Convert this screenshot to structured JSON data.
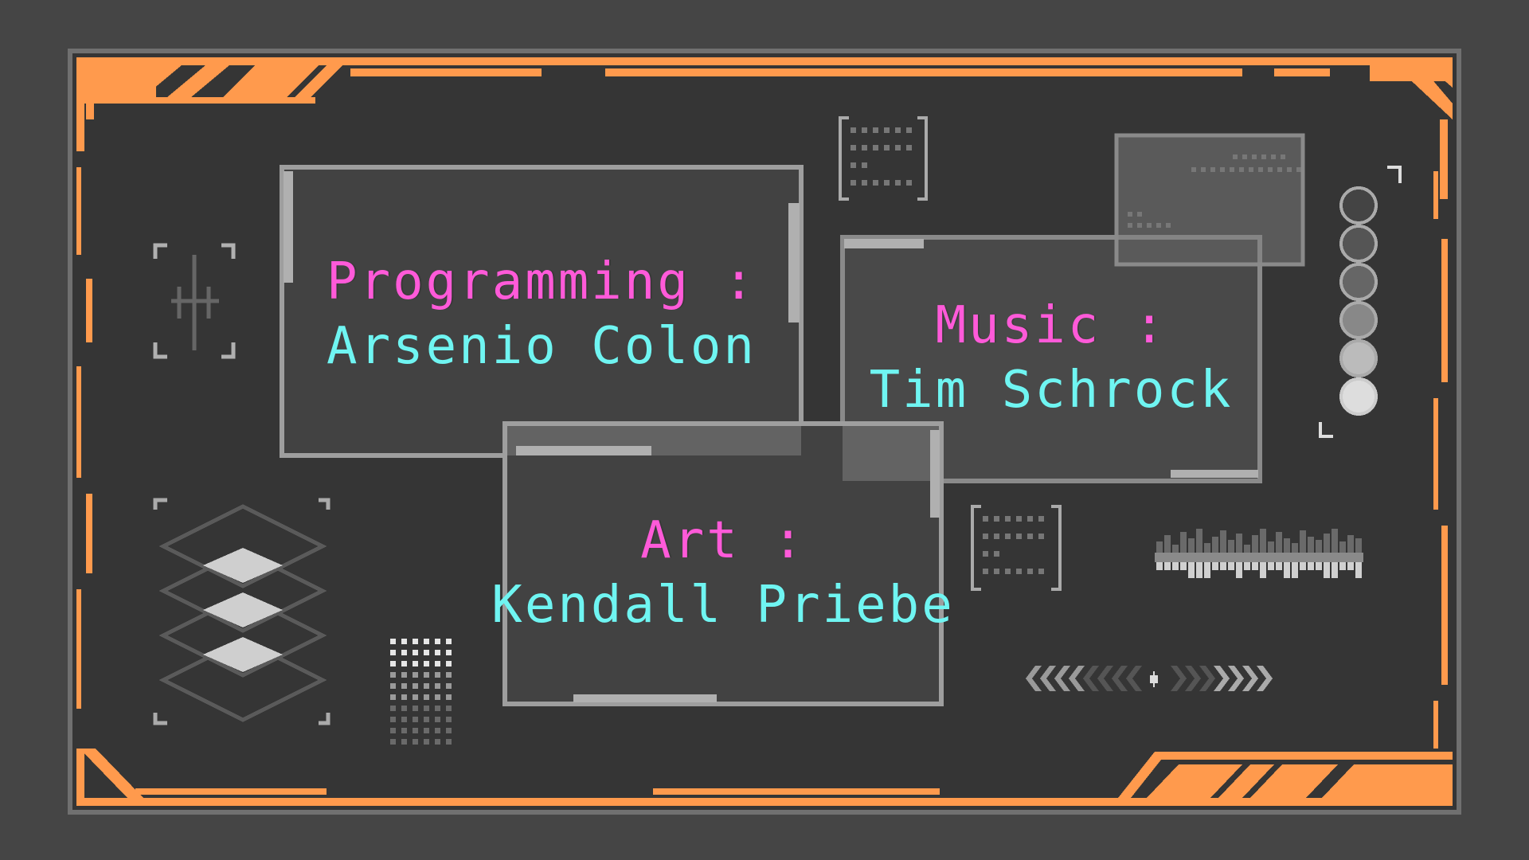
{
  "colors": {
    "background": "#454545",
    "panel": "#353535",
    "accent_orange": "#ff9a4d",
    "role_text": "#ff5ad9",
    "name_text": "#6ff5f2",
    "card_border": "#9a9a9a"
  },
  "credits": [
    {
      "role": "Programming :",
      "name": "Arsenio Colon"
    },
    {
      "role": "Music :",
      "name": "Tim Schrock"
    },
    {
      "role": "Art :",
      "name": "Kendall Priebe"
    }
  ],
  "decorations": [
    "crosshair-icon",
    "stacked-diamonds-icon",
    "dot-grid-icon",
    "bracket-dots-icon",
    "circle-column-icon",
    "waveform-icon",
    "chevron-strip-icon",
    "mini-panel-icon"
  ]
}
